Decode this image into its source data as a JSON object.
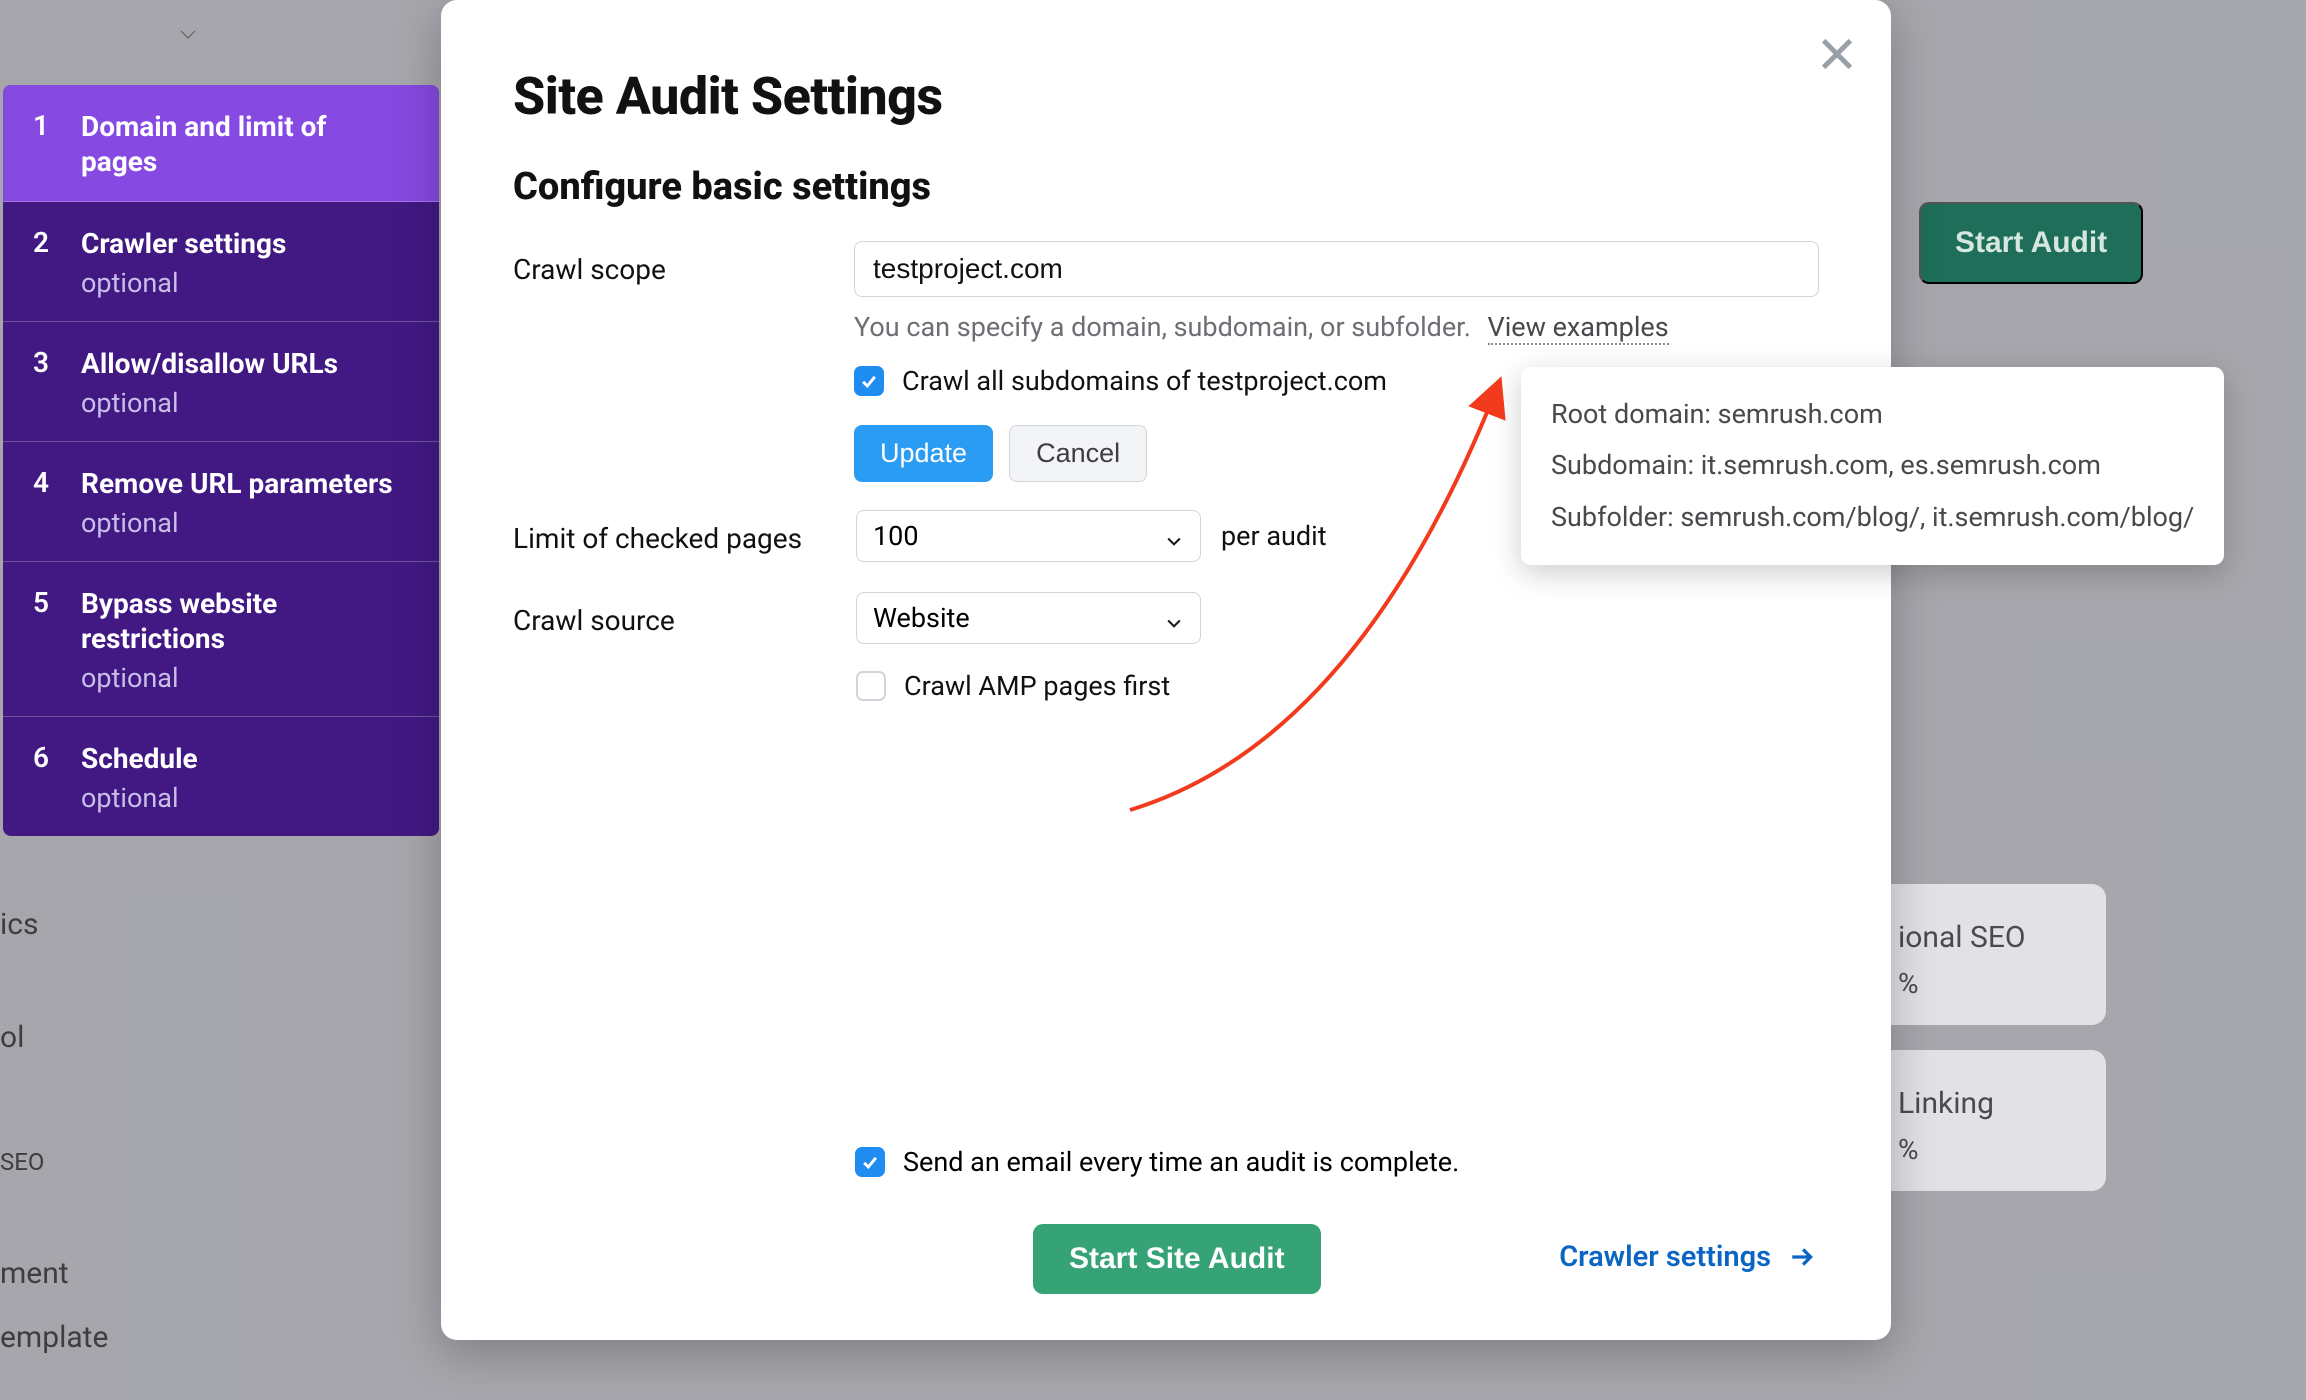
{
  "bg": {
    "start_audit": "Start Audit",
    "card_seo_label": "ional SEO",
    "card_seo_pct": "%",
    "card_link_label": " Linking",
    "card_link_pct": "%",
    "side1": "ics",
    "side2": "ol",
    "side3": "SEO",
    "side4": "ment",
    "side5": "emplate"
  },
  "steps": [
    {
      "num": "1",
      "title": "Domain and limit of pages",
      "tag": ""
    },
    {
      "num": "2",
      "title": "Crawler settings",
      "tag": "optional"
    },
    {
      "num": "3",
      "title": "Allow/disallow URLs",
      "tag": "optional"
    },
    {
      "num": "4",
      "title": "Remove URL parameters",
      "tag": "optional"
    },
    {
      "num": "5",
      "title": "Bypass website restrictions",
      "tag": "optional"
    },
    {
      "num": "6",
      "title": "Schedule",
      "tag": "optional"
    }
  ],
  "modal": {
    "title": "Site Audit Settings",
    "subtitle": "Configure basic settings",
    "crawl_scope_label": "Crawl scope",
    "crawl_scope_value": "testproject.com",
    "hint_text": "You can specify a domain, subdomain, or subfolder.",
    "view_examples": "View examples",
    "crawl_subdomains": "Crawl all subdomains of testproject.com",
    "update_btn": "Update",
    "cancel_btn": "Cancel",
    "limit_label": "Limit of checked pages",
    "limit_value": "100",
    "per_audit": "per audit",
    "crawl_source_label": "Crawl source",
    "crawl_source_value": "Website",
    "crawl_amp": "Crawl AMP pages first",
    "email_line": "Send an email every time an audit is complete.",
    "start_btn": "Start Site Audit",
    "crawler_settings_link": "Crawler settings"
  },
  "tooltip": {
    "line1": "Root domain: semrush.com",
    "line2": "Subdomain: it.semrush.com, es.semrush.com",
    "line3": "Subfolder: semrush.com/blog/, it.semrush.com/blog/"
  }
}
